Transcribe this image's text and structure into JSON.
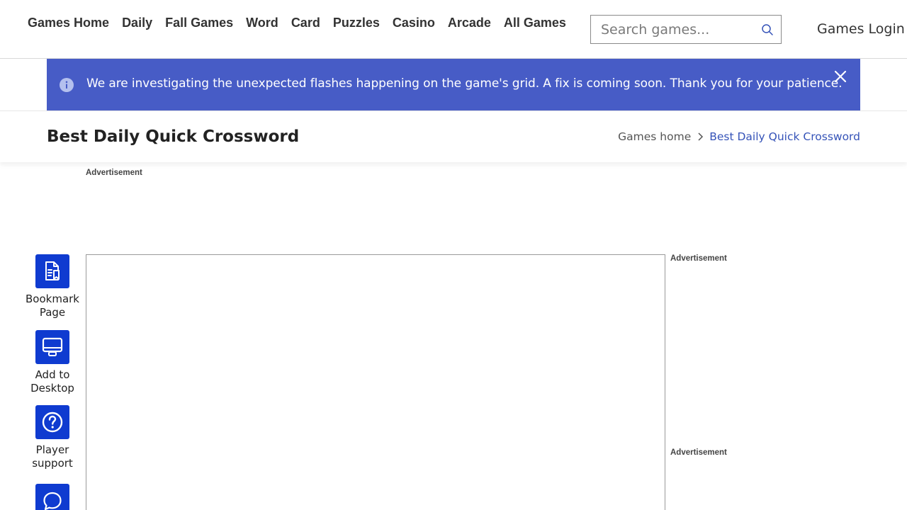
{
  "nav": {
    "links": [
      "Games Home",
      "Daily",
      "Fall Games",
      "Word",
      "Card",
      "Puzzles",
      "Casino",
      "Arcade",
      "All Games"
    ],
    "search_placeholder": "Search games...",
    "login_label": "Games Login"
  },
  "banner": {
    "message": "We are investigating the unexpected flashes happening on the game's grid. A fix is coming soon. Thank you for your patience.",
    "color": "#475cc6"
  },
  "page": {
    "title": "Best Daily Quick Crossword",
    "breadcrumb": {
      "home": "Games home",
      "current": "Best Daily Quick Crossword"
    }
  },
  "ads": {
    "top_label": "Advertisement",
    "right_label_1": "Advertisement",
    "right_label_2": "Advertisement"
  },
  "side_actions": [
    {
      "label_line1": "Bookmark",
      "label_line2": "Page",
      "icon": "bookmark-page-icon"
    },
    {
      "label_line1": "Add to",
      "label_line2": "Desktop",
      "icon": "desktop-icon"
    },
    {
      "label_line1": "Player",
      "label_line2": "support",
      "icon": "help-icon"
    },
    {
      "label_line1": "",
      "label_line2": "",
      "icon": "chat-icon"
    }
  ],
  "colors": {
    "accent": "#0f3bd0",
    "link": "#3553b8"
  }
}
